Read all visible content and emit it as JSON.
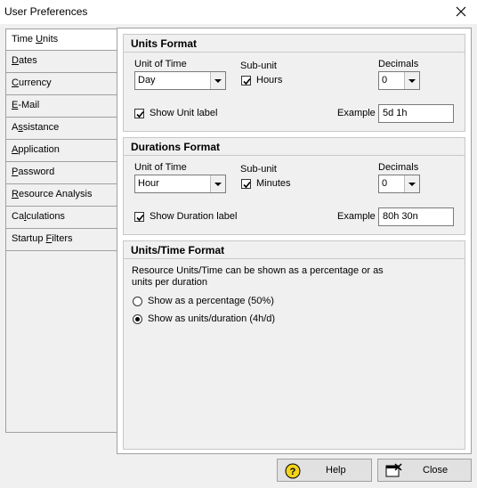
{
  "window": {
    "title": "User Preferences",
    "close_icon": "close-icon"
  },
  "tabs": [
    {
      "label": "Time Units",
      "pre": "Time ",
      "key": "U",
      "post": "nits",
      "active": true
    },
    {
      "label": "Dates",
      "pre": "",
      "key": "D",
      "post": "ates",
      "active": false
    },
    {
      "label": "Currency",
      "pre": "",
      "key": "C",
      "post": "urrency",
      "active": false
    },
    {
      "label": "E-Mail",
      "pre": "",
      "key": "E",
      "post": "-Mail",
      "active": false
    },
    {
      "label": "Assistance",
      "pre": "A",
      "key": "s",
      "post": "sistance",
      "active": false
    },
    {
      "label": "Application",
      "pre": "",
      "key": "A",
      "post": "pplication",
      "active": false
    },
    {
      "label": "Password",
      "pre": "",
      "key": "P",
      "post": "assword",
      "active": false
    },
    {
      "label": "Resource Analysis",
      "pre": "",
      "key": "R",
      "post": "esource Analysis",
      "active": false
    },
    {
      "label": "Calculations",
      "pre": "Ca",
      "key": "l",
      "post": "culations",
      "active": false
    },
    {
      "label": "Startup Filters",
      "pre": "Startup ",
      "key": "F",
      "post": "ilters",
      "active": false
    }
  ],
  "units_format": {
    "header": "Units Format",
    "unit_of_time_label": "Unit of Time",
    "unit_of_time_value": "Day",
    "subunit_label": "Sub-unit",
    "subunit_checkbox": "Hours",
    "subunit_checked": true,
    "decimals_label": "Decimals",
    "decimals_value": "0",
    "show_label_checkbox": "Show Unit label",
    "show_label_checked": true,
    "example_label": "Example",
    "example_value": "5d 1h"
  },
  "durations_format": {
    "header": "Durations Format",
    "unit_of_time_label": "Unit of Time",
    "unit_of_time_value": "Hour",
    "subunit_label": "Sub-unit",
    "subunit_checkbox": "Minutes",
    "subunit_checked": true,
    "decimals_label": "Decimals",
    "decimals_value": "0",
    "show_label_checkbox": "Show Duration label",
    "show_label_checked": true,
    "example_label": "Example",
    "example_value": "80h 30n"
  },
  "units_time_format": {
    "header": "Units/Time Format",
    "description_line1": "Resource Units/Time can be shown as a percentage or as",
    "description_line2": "units per duration",
    "option_percentage": "Show as a percentage (50%)",
    "option_units": "Show as units/duration (4h/d)",
    "selected": "units"
  },
  "footer": {
    "help_label": "Help",
    "help_icon": "help-icon",
    "close_label": "Close",
    "close_icon": "close-window-icon"
  }
}
